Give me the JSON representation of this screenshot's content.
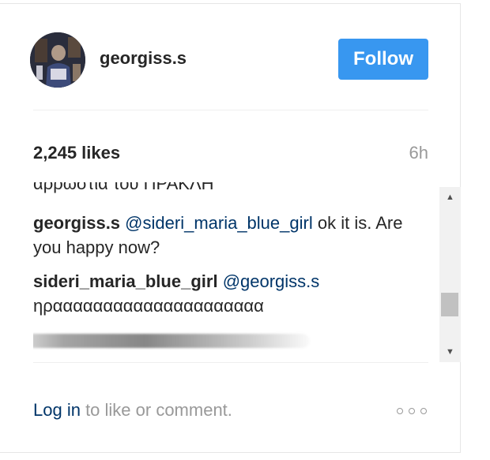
{
  "post_header": {
    "username": "georgiss.s",
    "follow_label": "Follow"
  },
  "stats": {
    "likes": "2,245 likes",
    "time": "6h"
  },
  "comments": {
    "partial_top": "αρρωστια του ΠΡΑΚΛΗ",
    "items": [
      {
        "author": "georgiss.s",
        "mention": "@sideri_maria_blue_girl",
        "text": "ok it is. Are you happy now?"
      },
      {
        "author": "sideri_maria_blue_girl",
        "mention": "@georgiss.s",
        "text": "ηρααααααααααααααααααααα"
      }
    ]
  },
  "scrollbar": {
    "up_icon": "▲",
    "down_icon": "▼",
    "position_fraction": 0.75
  },
  "footer": {
    "login_label": "Log in",
    "login_suffix": " to like or comment.",
    "more_icon": "more-options-icon"
  },
  "colors": {
    "accent": "#3897f0",
    "link": "#003569",
    "muted": "#999999",
    "text": "#262626"
  }
}
